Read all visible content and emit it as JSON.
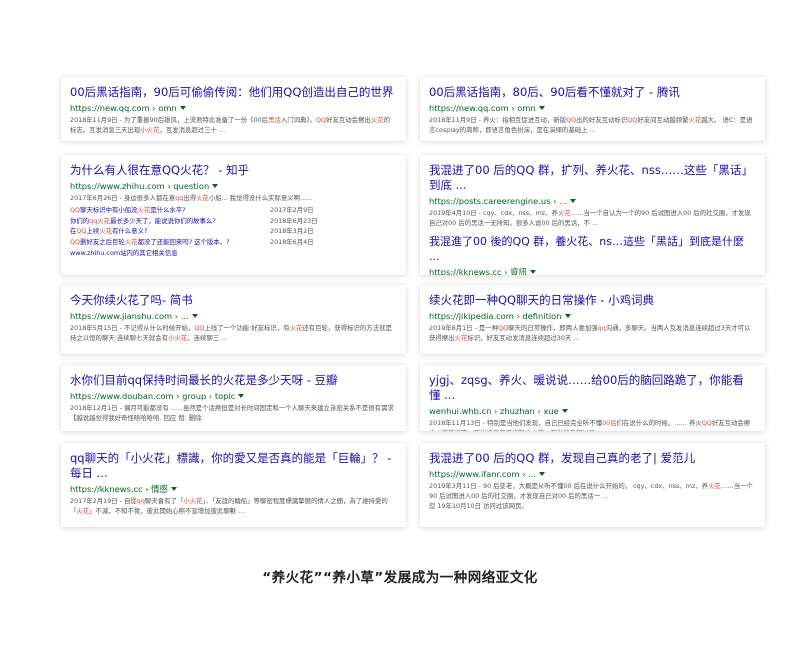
{
  "colors": {
    "title": "#1a0dab",
    "url": "#006621",
    "snippet": "#545454",
    "highlight": "#dd4b39"
  },
  "left": [
    {
      "title": "00后黑话指南，90后可偷偷传阅：他们用QQ创造出自己的世界",
      "url": "https://new.qq.com › omn",
      "snippet": [
        "2018年11月9日 - 为了重振90后雄风，上流君特此准备了一份《00后",
        {
          "h": "黑话"
        },
        "入门词典》。",
        {
          "h": "QQ"
        },
        "好友互动会擦出",
        {
          "h": "火花"
        },
        "的标志。互发消息三天出现",
        {
          "h": "小火花"
        },
        "，互发消息超过三十 ..."
      ]
    },
    {
      "title": "为什么有人很在意QQ火花？ - 知乎",
      "url": "https://www.zhihu.com › question",
      "snippet": [
        "2017年6月26日 - 身边很多人都在意",
        {
          "h": "qq"
        },
        "出得",
        {
          "h": "火花"
        },
        "小船... 我觉得没什么实际意义啊......"
      ],
      "sublinks": [
        {
          "text": [
            {
              "h": "QQ"
            },
            "聊天标识中有小船没",
            {
              "h": "火花"
            },
            "是什么水平?"
          ],
          "date": "2017年2月9日"
        },
        {
          "text": [
            "你们的",
            {
              "h": "qq火花"
            },
            "最长多少天了，能说说你们的故事么?"
          ],
          "date": "2018年6月23日"
        },
        {
          "text": [
            "在",
            {
              "h": "QQ"
            },
            "上续",
            {
              "h": "火花"
            },
            "有什么意义?"
          ],
          "date": "2018年3月2日"
        },
        {
          "text": [
            {
              "h": "QQ"
            },
            "删好友之后巨轮",
            {
              "h": "火花"
            },
            "都没了还能回来吗? 这个版本。?"
          ],
          "date": "2018年6月4日"
        }
      ],
      "more": "www.zhihu.com站内的其它相关信息"
    },
    {
      "title": "今天你续火花了吗- 简书",
      "url": "https://www.jianshu.com › ...",
      "snippet": [
        "2018年5月15日 - 不记得从什么时候开始，",
        {
          "h": "QQ"
        },
        "上线了一个功能:好友标识，有",
        {
          "h": "火花"
        },
        "还有巨轮，获得标识的方法就是持之以恒的聊天:连续聊七天就会有",
        {
          "h": "小火花"
        },
        "，连续聊三 ..."
      ]
    },
    {
      "title": "水你们目前qq保持时间最长的火花是多少天呀 - 豆瓣",
      "url": "https://www.douban.com › group › topic",
      "snippet": [
        "2018年12月1日 - 偶月可能都没有 ......虽然是个话痨但是对长时间固定和一个人聊天来建立亲密关系不是很有需求【越说越觉得我好奇怪哈哈哈哈. 回应 赞. 删除."
      ]
    },
    {
      "title": "qq聊天的「小火花」標識，你的愛又是否真的能是「巨輪」？ - 每日 ...",
      "url": "https://kknews.cc › 情感",
      "snippet": [
        "2017年2月19日 - 自從",
        {
          "h": "qq"
        },
        "聊天會有了「",
        {
          "h": "小火花"
        },
        "」、「友誼的輪船」等聊密程度標識摯戀的情人之間，為了維持愛的「",
        {
          "h": "火花"
        },
        "」不滅，不知不覺，彼此開始心照不宣增加彼此聊數 ..."
      ]
    }
  ],
  "right": [
    {
      "title": "00后黑话指南，80后、90后看不懂就对了 - 腾讯",
      "url": "https://new.qq.com › omn",
      "snippet": [
        "2018年11月9日 - 养火：指相互促进互动，新版",
        {
          "h": "QQ"
        },
        "出的好友互动标识",
        {
          "h": "QQ"
        },
        "好友间互动越频繁",
        {
          "h": "火花"
        },
        "越大。 语C：是语言cosplay的简称，即语言角色扮演，是在演绎的基础上 ..."
      ]
    },
    {
      "title": "我混进了00 后的QQ 群，扩列、养火花、nss……这些「黑话」到底 ...",
      "url": "https://posts.careerengine.us › ...",
      "snippet": [
        "2019年4月10日 - cqy、cdx、nss、mz、养",
        {
          "h": "火花"
        },
        "……当一个自认为一个的90 后试图进入00 后的社交圈，才发现自己对00 后的黑话一无所知。很多人说00 后的黑话，不 ..."
      ],
      "title2": "我混進了00 後的QQ 群，養火花、ns…這些「黑話」到底是什麼 ...",
      "url2": "https://kknews.cc › 資訊"
    },
    {
      "title": "续火花即一种QQ聊天的日常操作 - 小鸡词典",
      "url": "https://jikipedia.com › definition",
      "snippet": [
        "2019年8月1日 - 是一种",
        {
          "h": "QQ"
        },
        "聊天的日常操作，即两人要加强",
        {
          "h": "qq"
        },
        "沟通，多聊天。当两人互发消息连续超过3天才可以获得擦出",
        {
          "h": "火花"
        },
        "标识，好友互动发消息连续超过30天 ..."
      ]
    },
    {
      "title": "yjgj、zqsg、养火、暖说说……给00后的脑回路跪了，你能看懂 ...",
      "url": "wenhui.whb.cn › zhuzhan › xue",
      "snippet": [
        "2018年11月13日 - 特别是当他们发现，自己已经完全听不懂",
        {
          "h": "00后"
        },
        "们在说什么的时候。…… 养火",
        {
          "h": "QQ"
        },
        "好友互动会擦出",
        {
          "h": "火花"
        },
        "的标志，互发消息三天出现",
        {
          "h": "小火花"
        },
        "，互发消息超过三 ..."
      ]
    },
    {
      "title": "我混进了00 后的QQ 群，发现自己真的老了| 爱范儿",
      "url": "https://www.ifanr.com › ...",
      "snippet": [
        "2019年3月11日 - 90 后变老，大概是从听不懂00 后在说什么开始的。 cqy、cdx、nss、mz、养",
        {
          "h": "火花"
        },
        "……当一个90 后试图进入00 后的社交圈，才发现自己对00 后的黑话一 ...",
        {
          "br": true
        },
        "您 19年10月10日 访问过该网页。"
      ]
    }
  ],
  "caption": "“养火花”“养小草”发展成为一种网络亚文化"
}
